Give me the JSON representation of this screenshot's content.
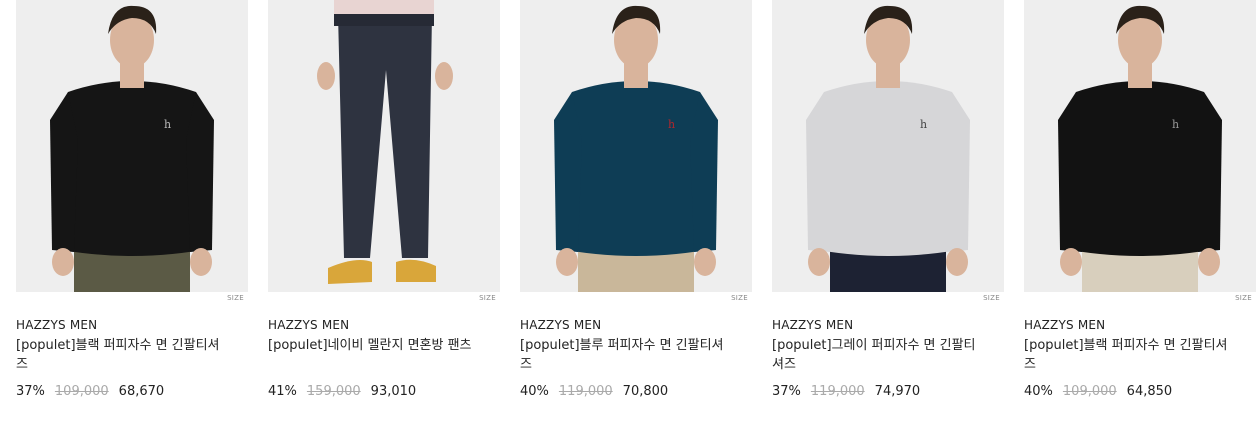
{
  "products": [
    {
      "brand": "HAZZYS MEN",
      "name": "[populet]블랙 퍼피자수 면 긴팔티셔즈",
      "discount": "37%",
      "original_price": "109,000",
      "sale_price": "68,670",
      "size_label": "SIZE",
      "garment": "tee",
      "shirt_color": "#151515",
      "bottom_color": "#5b5a45",
      "logo_color": "#bbbbbb"
    },
    {
      "brand": "HAZZYS MEN",
      "name": "[populet]네이비 멜란지 면혼방 팬츠",
      "discount": "41%",
      "original_price": "159,000",
      "sale_price": "93,010",
      "size_label": "SIZE",
      "garment": "pants",
      "shirt_color": "#e8d4d2",
      "bottom_color": "#2e3340",
      "logo_color": "#d9a63a"
    },
    {
      "brand": "HAZZYS MEN",
      "name": "[populet]블루 퍼피자수 면 긴팔티셔즈",
      "discount": "40%",
      "original_price": "119,000",
      "sale_price": "70,800",
      "size_label": "SIZE",
      "garment": "tee",
      "shirt_color": "#0e3d55",
      "bottom_color": "#c9b79a",
      "logo_color": "#b3262c"
    },
    {
      "brand": "HAZZYS MEN",
      "name": "[populet]그레이 퍼피자수 면 긴팔티셔즈",
      "discount": "37%",
      "original_price": "119,000",
      "sale_price": "74,970",
      "size_label": "SIZE",
      "garment": "tee",
      "shirt_color": "#d6d6d8",
      "bottom_color": "#1d2233",
      "logo_color": "#444444"
    },
    {
      "brand": "HAZZYS MEN",
      "name": "[populet]블랙 퍼피자수 면 긴팔티셔즈",
      "discount": "40%",
      "original_price": "109,000",
      "sale_price": "64,850",
      "size_label": "SIZE",
      "garment": "tee",
      "shirt_color": "#121212",
      "bottom_color": "#d8cfbd",
      "logo_color": "#999999"
    }
  ]
}
